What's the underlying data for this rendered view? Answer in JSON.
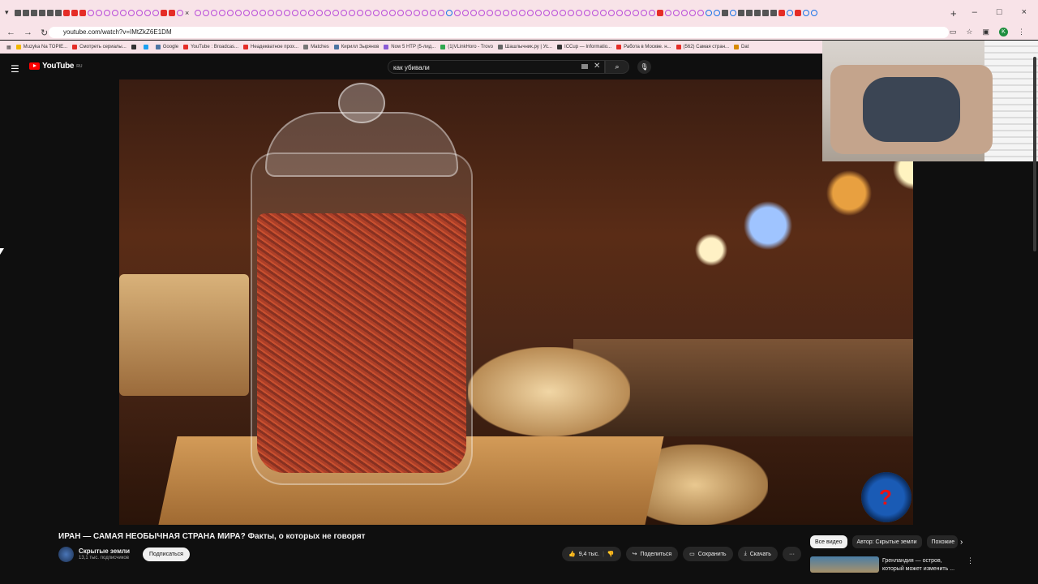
{
  "browser": {
    "url": "youtube.com/watch?v=IMtZkZ6E1DM",
    "tab_close": "×",
    "new_tab": "+",
    "window_controls": [
      "–",
      "□",
      "×"
    ],
    "nav": {
      "back": "←",
      "forward": "→",
      "reload": "↻"
    },
    "profile_initial": "K",
    "bookmarks": [
      "Muzyka Na TOPIE...",
      "Смотреть сериалы...",
      "",
      "",
      "Google",
      "YouTube : Broadcas...",
      "Неадекватное прох...",
      "Matches",
      "Кирилл Зырянов",
      "Now 5 HTP (5-лид...",
      "(1)VLinkHoro - Trovo",
      "Шашлычник.ру | Ус...",
      "ICCup — Informatio...",
      "Работа в Москве. н...",
      "(562) Самая стран...",
      "Dat"
    ]
  },
  "youtube": {
    "logo_text": "YouTube",
    "logo_region": "RU",
    "search_value": "как убивали",
    "video": {
      "title": "ИРАН — САМАЯ НЕОБЫЧНАЯ СТРАНА МИРА? Факты, о которых не говорят",
      "channel": "Скрытые земли",
      "subscribers": "13,1 тыс. подписчиков",
      "subscribe_label": "Подписаться",
      "likes": "9,4 тыс.",
      "share_label": "Поделиться",
      "save_label": "Сохранить",
      "download_label": "Скачать",
      "more_label": "···"
    },
    "chips": [
      "Все видео",
      "Автор: Скрытые земли",
      "Похожие"
    ],
    "recommendation": {
      "title": "Гренландия — остров, который может изменить ..."
    }
  }
}
